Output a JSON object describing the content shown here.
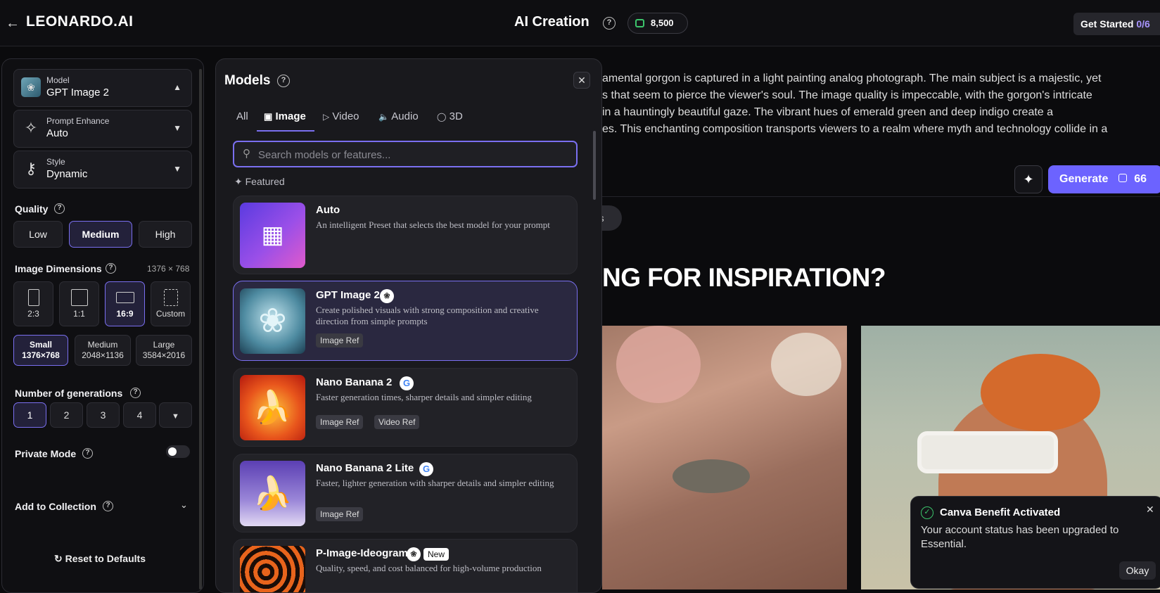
{
  "header": {
    "back_icon": "arrow-left-icon",
    "logo": "LEONARDO.AI",
    "title": "AI Creation",
    "credits": "8,500",
    "get_started": "Get Started",
    "get_started_count": "0/6"
  },
  "left_panel": {
    "model": {
      "label": "Model",
      "value": "GPT Image 2"
    },
    "prompt_enhance": {
      "label": "Prompt Enhance",
      "value": "Auto"
    },
    "style": {
      "label": "Style",
      "value": "Dynamic"
    },
    "quality": {
      "title": "Quality",
      "options": [
        "Low",
        "Medium",
        "High"
      ],
      "selected": "Medium"
    },
    "dimensions": {
      "title": "Image Dimensions",
      "current": "1376 × 768",
      "ratios": [
        "2:3",
        "1:1",
        "16:9",
        "Custom"
      ],
      "selected_ratio": "16:9",
      "sizes": [
        {
          "name": "Small",
          "res": "1376×768"
        },
        {
          "name": "Medium",
          "res": "2048×1136"
        },
        {
          "name": "Large",
          "res": "3584×2016"
        }
      ],
      "selected_size": "Small"
    },
    "generations": {
      "title": "Number of generations",
      "options": [
        "1",
        "2",
        "3",
        "4"
      ],
      "selected": "1"
    },
    "private_mode": {
      "title": "Private Mode",
      "on": false
    },
    "add_to_collection": "Add to Collection",
    "reset": "Reset to Defaults"
  },
  "modal": {
    "title": "Models",
    "tabs": [
      "All",
      "Image",
      "Video",
      "Audio",
      "3D"
    ],
    "active_tab": "Image",
    "search_placeholder": "Search models or features...",
    "featured_label": "Featured",
    "models": [
      {
        "name": "Auto",
        "desc": "An intelligent Preset that selects the best model for your prompt",
        "tags": []
      },
      {
        "name": "GPT Image 2",
        "desc": "Create polished visuals with strong composition and creative direction from simple prompts",
        "tags": [
          "Image Ref"
        ]
      },
      {
        "name": "Nano Banana 2",
        "desc": "Faster generation times, sharper details and simpler editing",
        "tags": [
          "Image Ref",
          "Video Ref"
        ]
      },
      {
        "name": "Nano Banana 2 Lite",
        "desc": "Faster, lighter generation with sharper details and simpler editing",
        "tags": [
          "Image Ref"
        ]
      },
      {
        "name": "P-Image-Ideogram",
        "desc": "Quality, speed, and cost balanced for high-volume production",
        "tags": [],
        "badge": "New"
      }
    ]
  },
  "prompt": {
    "lines": [
      "amental gorgon is captured in a light painting analog photograph. The main subject is a majestic, yet",
      "s that seem to pierce the viewer's soul. The image quality is impeccable, with the gorgon's intricate",
      "in a hauntingly beautiful gaze. The vibrant hues of emerald green and deep indigo create a",
      "es. This enchanting composition transports viewers to a realm where myth and technology collide in a"
    ]
  },
  "generate": {
    "label": "Generate",
    "cost": "66"
  },
  "chip_text": "nts",
  "inspiration_heading": "NG FOR INSPIRATION?",
  "toast": {
    "title": "Canva Benefit Activated",
    "message": "Your account status has been upgraded to Essential.",
    "button": "Okay"
  },
  "colors": {
    "accent": "#6c63ff",
    "selected_border": "#7a6ff0",
    "success": "#3cc46b"
  }
}
